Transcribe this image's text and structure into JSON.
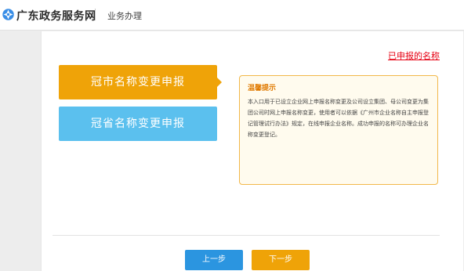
{
  "header": {
    "site_name": "广东政务服务网",
    "section": "业务办理"
  },
  "main": {
    "applied_names_link": "已申报的名称",
    "options": [
      {
        "label": "冠市名称变更申报"
      },
      {
        "label": "冠省名称变更申报"
      }
    ],
    "tip": {
      "title": "温馨提示",
      "body": "本入口用于已设立企业网上申报名称变更及公司设立集团、母公司变更为集团公司时网上申报名称变更，使用者可以依据《广州市企业名称自主申报登记管理试行办法》规定，在线申报企业名称。成功申报的名称可办理企业名称变更登记。"
    },
    "prev_label": "上一步",
    "next_label": "下一步"
  },
  "colors": {
    "accent_orange": "#efa308",
    "accent_blue": "#5bc0ee",
    "prev_blue": "#2b95e0",
    "link_red": "#e60012"
  },
  "icons": {
    "logo": "government-logo-icon"
  }
}
